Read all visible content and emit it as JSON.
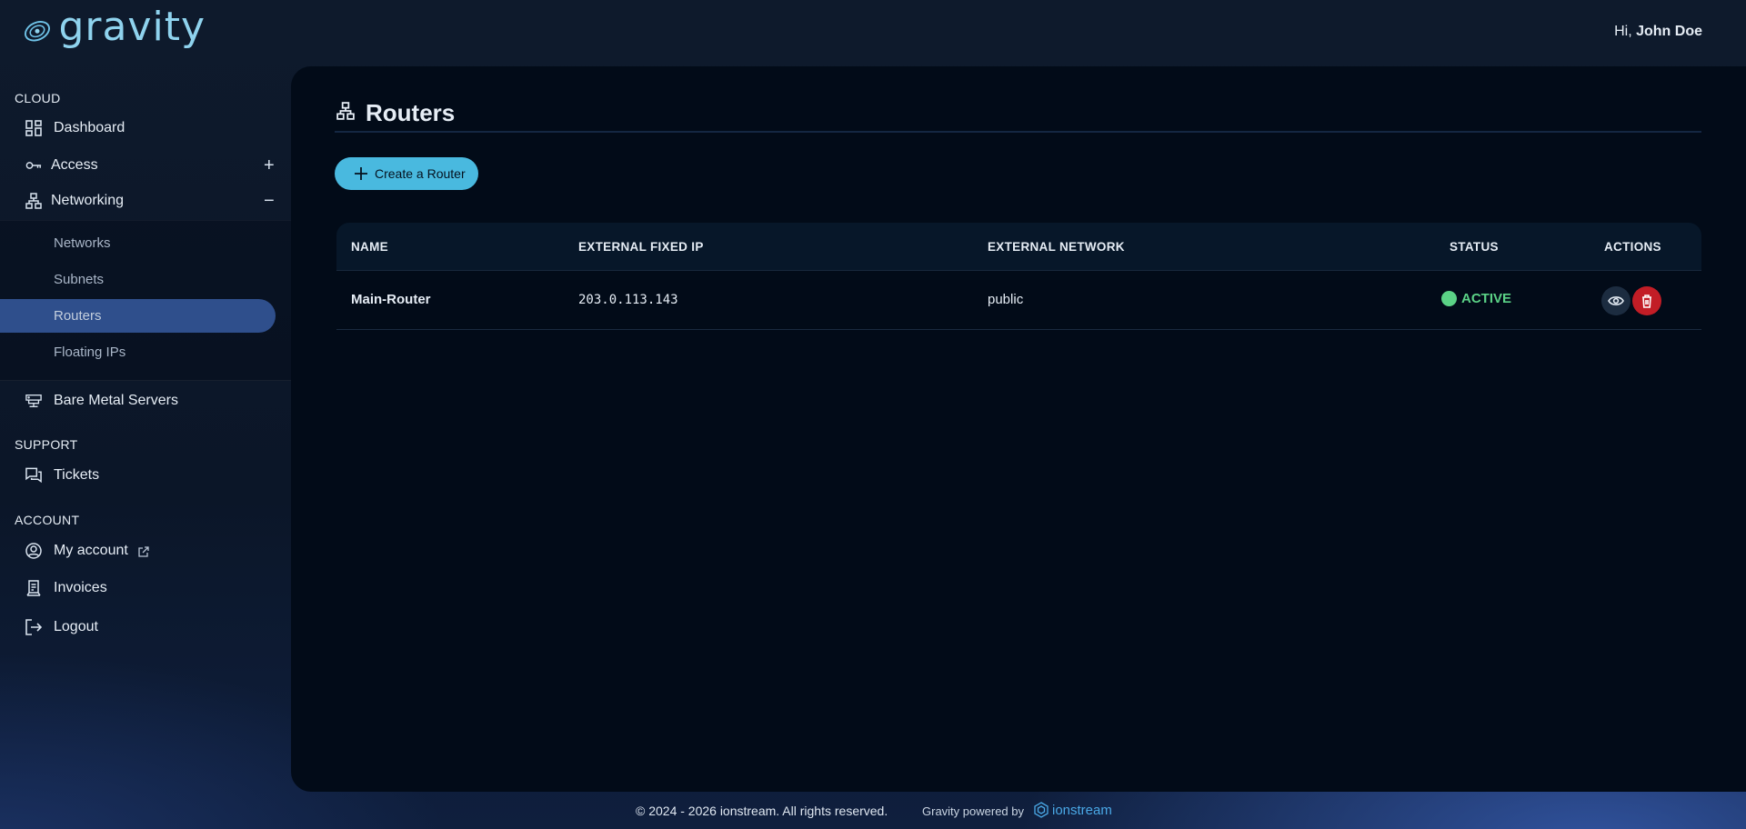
{
  "brand": {
    "name": "gravity",
    "primary_color": "#8fd3ee"
  },
  "header": {
    "greeting_prefix": "Hi,",
    "user_name": "John Doe"
  },
  "sidebar": {
    "sections": {
      "cloud": "CLOUD",
      "support": "SUPPORT",
      "account": "ACCOUNT"
    },
    "items": {
      "dashboard": {
        "label": "Dashboard",
        "icon": "dashboard-grid-icon"
      },
      "access": {
        "label": "Access",
        "icon": "key-icon",
        "toggle": "+"
      },
      "networking": {
        "label": "Networking",
        "icon": "network-icon",
        "toggle": "−"
      },
      "networks": {
        "label": "Networks"
      },
      "subnets": {
        "label": "Subnets"
      },
      "routers": {
        "label": "Routers",
        "active": true
      },
      "floating_ips": {
        "label": "Floating IPs"
      },
      "bare_metal": {
        "label": "Bare Metal Servers",
        "icon": "server-icon"
      },
      "tickets": {
        "label": "Tickets",
        "icon": "chat-icon"
      },
      "my_account": {
        "label": "My account",
        "icon": "user-circle-icon"
      },
      "invoices": {
        "label": "Invoices",
        "icon": "receipt-icon"
      },
      "logout": {
        "label": "Logout",
        "icon": "logout-icon"
      }
    },
    "active_color": "#2f4f8c"
  },
  "main": {
    "title": "Routers",
    "create_button_label": "Create a Router",
    "accent_color": "#49b9df",
    "table": {
      "headers": {
        "name": "NAME",
        "external_ip": "EXTERNAL FIXED IP",
        "external_network": "EXTERNAL NETWORK",
        "status": "STATUS",
        "actions": "ACTIONS"
      },
      "rows": [
        {
          "name": "Main-Router",
          "external_ip": "203.0.113.143",
          "external_network": "public",
          "status": "ACTIVE",
          "status_color": "#5bd286"
        }
      ]
    }
  },
  "footer": {
    "copyright": "© 2024 - 2026 ionstream. All rights reserved.",
    "powered_by": "Gravity powered by",
    "partner_name": "ionstream"
  }
}
